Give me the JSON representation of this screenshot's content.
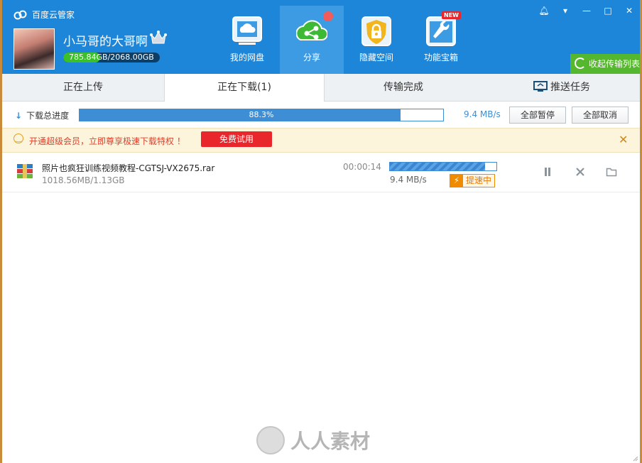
{
  "app": {
    "title": "百度云管家"
  },
  "user": {
    "name": "小马哥的大哥啊",
    "quota_used": "785.84GB",
    "quota_total": "/2068.00GB",
    "quota_fraction": 0.38
  },
  "nav": [
    {
      "label": "我的网盘",
      "icon": "cloud-drive-icon"
    },
    {
      "label": "分享",
      "icon": "share-icon"
    },
    {
      "label": "隐藏空间",
      "icon": "lock-icon"
    },
    {
      "label": "功能宝箱",
      "icon": "toolbox-icon",
      "badge": "NEW"
    }
  ],
  "window_controls": [
    "bell-icon",
    "dropdown-icon",
    "minimize-icon",
    "maximize-icon",
    "close-icon"
  ],
  "collapse_label": "收起传输列表",
  "tabs": [
    {
      "label": "正在上传"
    },
    {
      "label": "正在下载(1)"
    },
    {
      "label": "传输完成"
    },
    {
      "label": "推送任务"
    }
  ],
  "progress": {
    "label": "下载总进度",
    "percent_text": "88.3%",
    "fraction": 0.883,
    "speed": "9.4 MB/s",
    "pause_all": "全部暂停",
    "cancel_all": "全部取消"
  },
  "promo": {
    "text": "开通超级会员，立即尊享极速下载特权 ！",
    "trial": "免费试用"
  },
  "download": {
    "file": "照片也疯狂训练视频教程-CGTSJ-VX2675.rar",
    "size": "1018.56MB/1.13GB",
    "time": "00:00:14",
    "fraction": 0.89,
    "speed": "9.4 MB/s",
    "boost": "提速中"
  },
  "watermark": "人人素材",
  "colors": {
    "header": "#1e86d9",
    "accent": "#3e8ed6",
    "green": "#55b72d",
    "red": "#e8262b"
  }
}
